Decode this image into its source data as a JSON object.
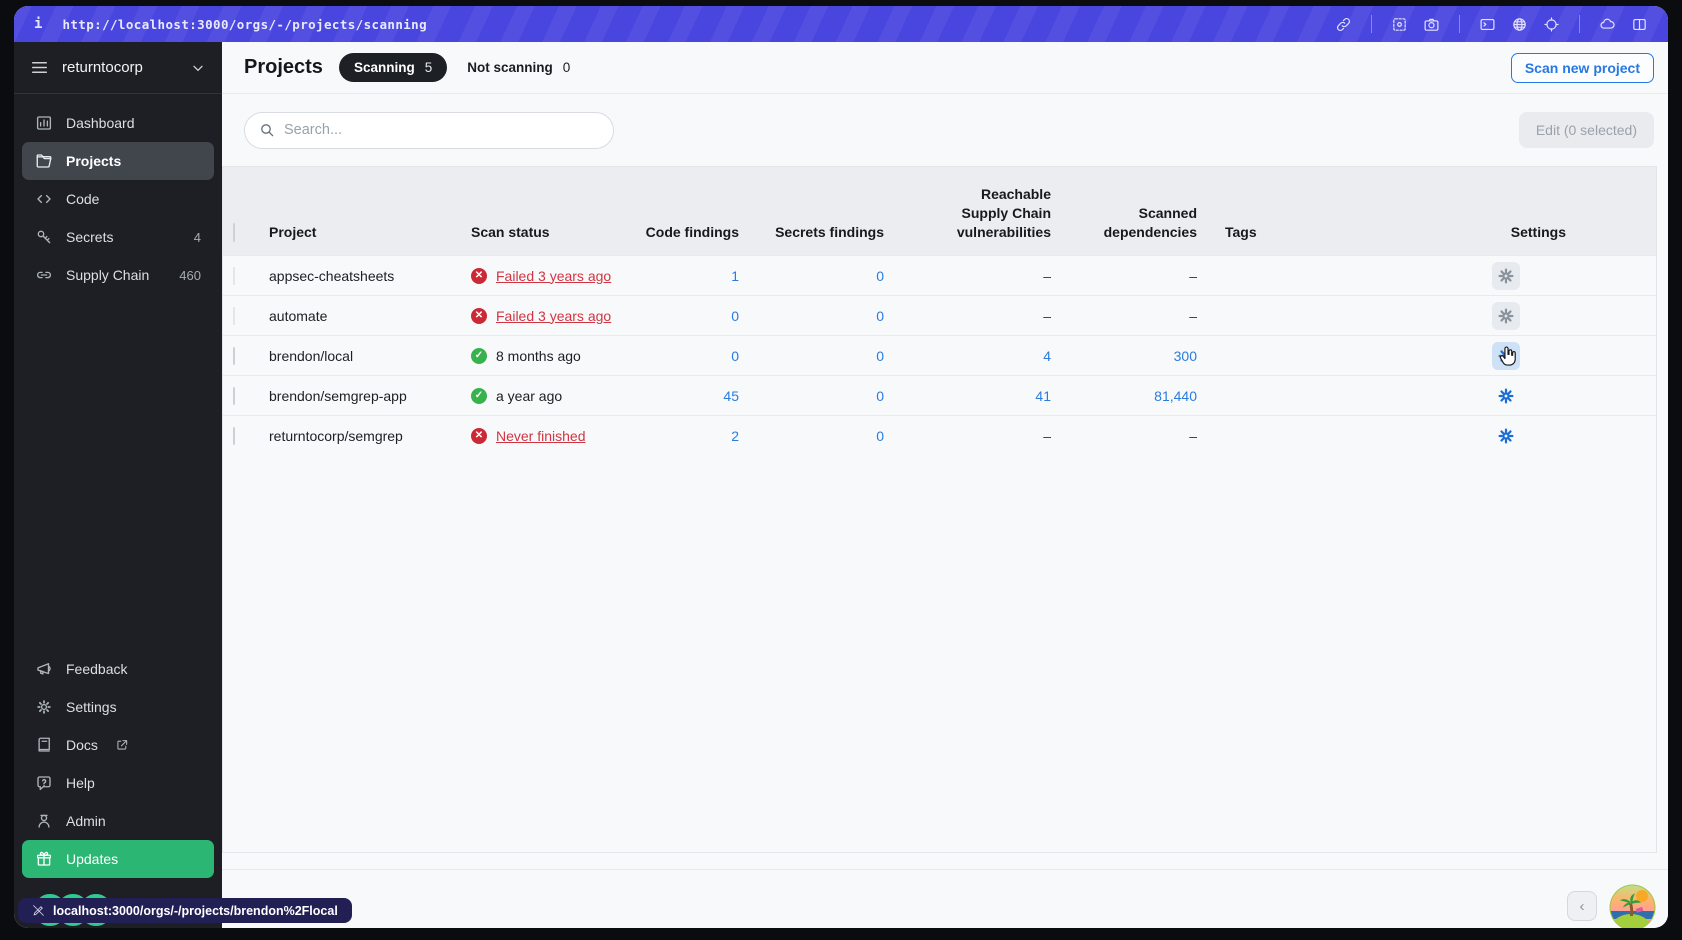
{
  "browser_bar": {
    "info_glyph": "i",
    "url": "http://localhost:3000/orgs/-/projects/scanning",
    "icons": [
      "link-icon",
      "screenshot-icon",
      "camera-icon",
      "terminal-icon",
      "globe-icon",
      "crosshair-icon",
      "cloud-icon",
      "split-view-icon"
    ]
  },
  "sidebar": {
    "org": "returntocorp",
    "items": [
      {
        "label": "Dashboard",
        "icon": "dashboard-icon"
      },
      {
        "label": "Projects",
        "icon": "folder-icon",
        "active": true
      },
      {
        "label": "Code",
        "icon": "code-icon"
      },
      {
        "label": "Secrets",
        "icon": "key-icon",
        "badge": "4"
      },
      {
        "label": "Supply Chain",
        "icon": "chain-icon",
        "badge": "460"
      }
    ],
    "footer_items": [
      {
        "label": "Feedback",
        "icon": "megaphone-icon"
      },
      {
        "label": "Settings",
        "icon": "gear-icon"
      },
      {
        "label": "Docs",
        "icon": "book-icon",
        "external": true
      },
      {
        "label": "Help",
        "icon": "help-icon"
      },
      {
        "label": "Admin",
        "icon": "admin-icon"
      },
      {
        "label": "Updates",
        "icon": "gift-icon",
        "highlighted": true
      }
    ],
    "logo": "semgrep-rings-logo"
  },
  "header": {
    "title": "Projects",
    "scanning_label": "Scanning",
    "scanning_count": "5",
    "not_scanning_label": "Not scanning",
    "not_scanning_count": "0",
    "scan_new_button": "Scan new project"
  },
  "toolbar": {
    "search_placeholder": "Search...",
    "edit_button": "Edit (0 selected)"
  },
  "table": {
    "columns": [
      "Project",
      "Scan status",
      "Code findings",
      "Secrets findings",
      "Reachable Supply Chain vulnerabilities",
      "Scanned dependencies",
      "Tags",
      "Settings"
    ],
    "rows": [
      {
        "project": "appsec-cheatsheets",
        "scan_status": "Failed 3 years ago",
        "scan_state": "failed",
        "code_findings": "1",
        "secrets_findings": "0",
        "reachable_vulns": "–",
        "scanned_deps": "–",
        "tags": ""
      },
      {
        "project": "automate",
        "scan_status": "Failed 3 years ago",
        "scan_state": "failed",
        "code_findings": "0",
        "secrets_findings": "0",
        "reachable_vulns": "–",
        "scanned_deps": "–",
        "tags": ""
      },
      {
        "project": "brendon/local",
        "scan_status": "8 months ago",
        "scan_state": "success",
        "code_findings": "0",
        "secrets_findings": "0",
        "reachable_vulns": "4",
        "scanned_deps": "300",
        "tags": ""
      },
      {
        "project": "brendon/semgrep-app",
        "scan_status": "a year ago",
        "scan_state": "success",
        "code_findings": "45",
        "secrets_findings": "0",
        "reachable_vulns": "41",
        "scanned_deps": "81,440",
        "tags": ""
      },
      {
        "project": "returntocorp/semgrep",
        "scan_status": "Never finished",
        "scan_state": "failed",
        "code_findings": "2",
        "secrets_findings": "0",
        "reachable_vulns": "–",
        "scanned_deps": "–",
        "tags": ""
      }
    ]
  },
  "status_tooltip": {
    "text": "localhost:3000/orgs/-/projects/brendon%2Flocal"
  },
  "footer": {
    "prev_label": "‹"
  },
  "colors": {
    "topbar_purple": "#4946df",
    "sidebar_dark": "#1d1f24",
    "updates_green": "#2bb673",
    "logo_green": "#2ecb8e",
    "accent_blue": "#2b7cdf",
    "danger_red": "#cc2936",
    "success_green": "#37b24d",
    "scanning_pill_dark": "#1d2024"
  }
}
